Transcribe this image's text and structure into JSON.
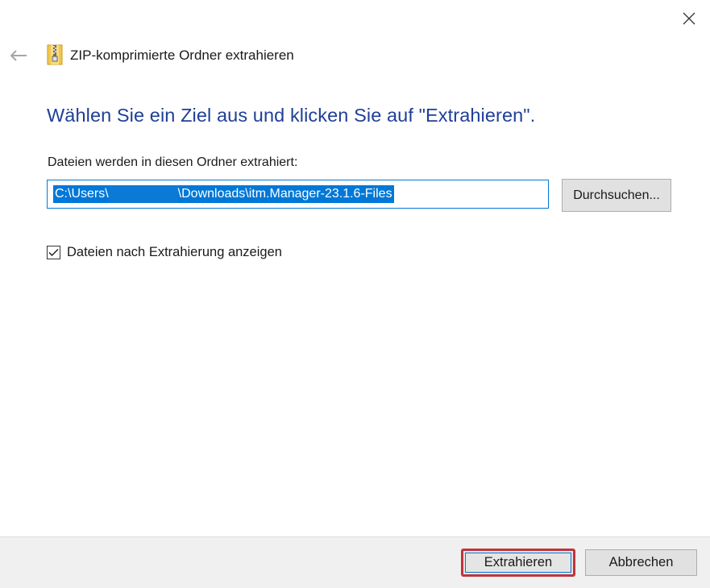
{
  "window": {
    "title": "ZIP-komprimierte Ordner extrahieren",
    "close_icon": "close-icon",
    "back_icon": "back-arrow-icon",
    "app_icon": "zip-folder-icon"
  },
  "main": {
    "instruction": "Wählen Sie ein Ziel aus und klicken Sie auf \"Extrahieren\".",
    "destination_label": "Dateien werden in diesen Ordner extrahiert:",
    "path_prefix": "C:\\Users\\",
    "path_suffix": "\\Downloads\\itm.Manager-23.1.6-Files",
    "browse_label": "Durchsuchen...",
    "show_files_label": "Dateien nach Extrahierung anzeigen",
    "show_files_checked": true
  },
  "footer": {
    "extract_label": "Extrahieren",
    "cancel_label": "Abbrechen"
  },
  "colors": {
    "accent": "#0078d7",
    "instruction_text": "#1f3f97",
    "highlight_border": "#c1343c",
    "footer_bg": "#f0f0f0"
  }
}
